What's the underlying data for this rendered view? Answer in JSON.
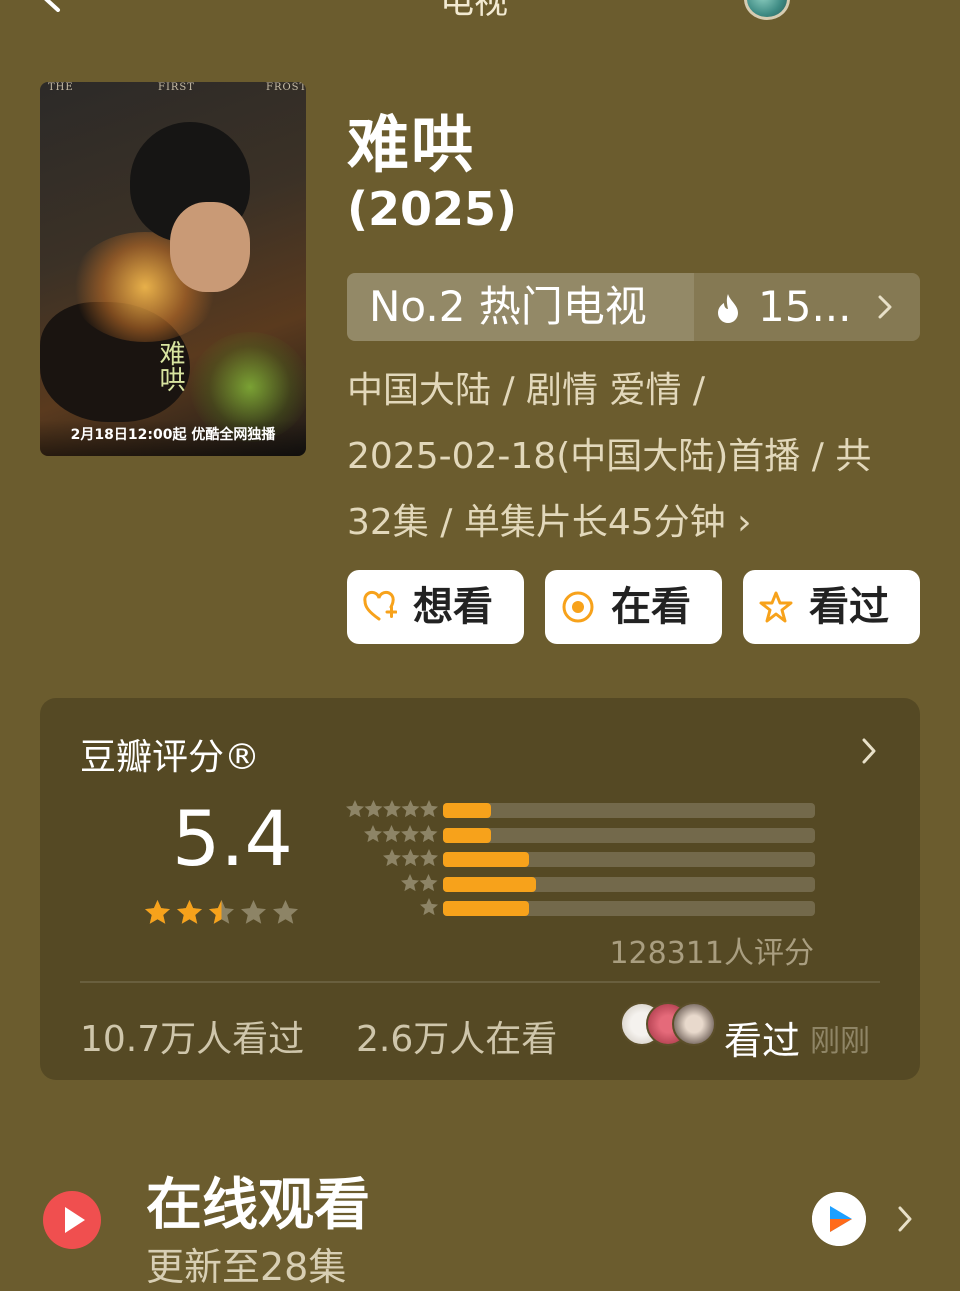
{
  "topbar": {
    "title": "电视"
  },
  "poster": {
    "top_words": [
      "THE",
      "FIRST",
      "FROST"
    ],
    "calligraphy": "难哄",
    "caption": "2月18日12:00起 优酷全网独播"
  },
  "show": {
    "title": "难哄",
    "year": "(2025)",
    "rank_label": "No.2 热门电视",
    "heat_value": "15...",
    "meta_lines": [
      "中国大陆 / 剧情 爱情 /",
      "2025-02-18(中国大陆)首播 / 共",
      "32集 / 单集片长45分钟 ›"
    ]
  },
  "actions": [
    {
      "label": "想看",
      "icon": "heart-plus-icon"
    },
    {
      "label": "在看",
      "icon": "target-circle-icon"
    },
    {
      "label": "看过",
      "icon": "star-outline-icon"
    }
  ],
  "rating": {
    "title": "豆瓣评分®",
    "score": "5.4",
    "stars": 2.5,
    "distribution": [
      {
        "stars": 5,
        "percent": 13
      },
      {
        "stars": 4,
        "percent": 13
      },
      {
        "stars": 3,
        "percent": 23
      },
      {
        "stars": 2,
        "percent": 25
      },
      {
        "stars": 1,
        "percent": 23
      }
    ],
    "count_text": "128311人评分",
    "watched": "10.7万人看过",
    "watching": "2.6万人在看",
    "friend_action": "看过",
    "friend_time": "刚刚",
    "colors": {
      "bar": "#f7a21b",
      "star": "#f7a21b"
    }
  },
  "online": {
    "title": "在线观看",
    "subtitle": "更新至28集",
    "platform_icon": "youku-icon"
  }
}
